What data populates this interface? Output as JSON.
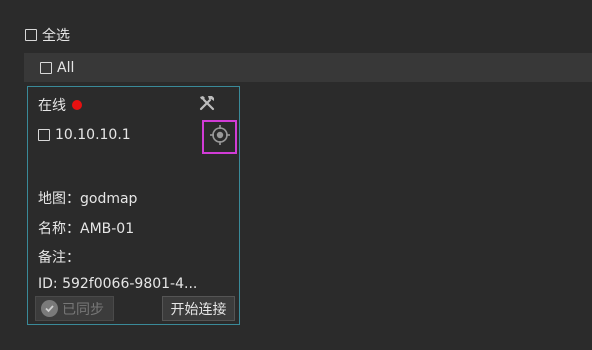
{
  "select_all": {
    "label": "全选",
    "checked": false
  },
  "all_bar": {
    "label": "All",
    "checked": false
  },
  "device_card": {
    "status_label": "在线",
    "status_color": "#e81010",
    "ip": "10.10.10.1",
    "ip_checked": false,
    "tools_icon": "tools-icon",
    "locate_icon": "crosshair-target-icon",
    "map_label": "地图：godmap",
    "name_label": "名称：AMB-01",
    "note_label": "备注：",
    "id_label": "ID: 592f0066-9801-4...",
    "synced_button_label": "已同步",
    "connect_button_label": "开始连接"
  },
  "colors": {
    "card_border": "#3a8a99",
    "highlight_border": "#d13cd6",
    "background": "#2b2b2b"
  }
}
